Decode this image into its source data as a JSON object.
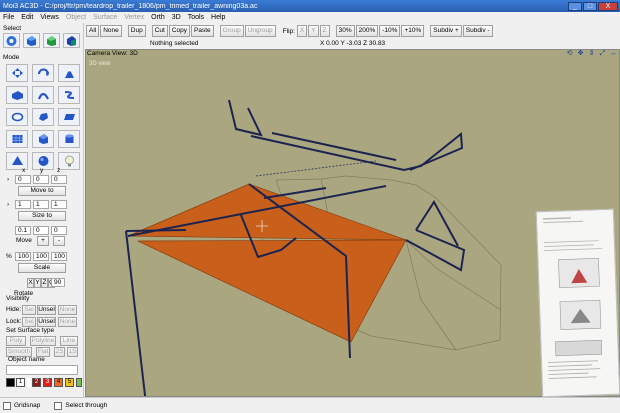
{
  "window": {
    "title": "Moi3 AC3D - C:/proj/ftr/pm/teardrop_trailer_1806/pm_trimed_trailer_awning03a.ac",
    "min": "_",
    "max": "□",
    "close": "X"
  },
  "menu": [
    "File",
    "Edit",
    "Views",
    "Object",
    "Surface",
    "Vertex",
    "Orth",
    "3D",
    "Tools",
    "Help"
  ],
  "menu_disabled": [
    false,
    false,
    false,
    true,
    true,
    true,
    false,
    false,
    false,
    false
  ],
  "toolbar": {
    "buttons": [
      "All",
      "None",
      "Dup",
      "Cut",
      "Copy",
      "Paste",
      "Group",
      "Ungroup"
    ],
    "disabled": [
      false,
      false,
      false,
      false,
      false,
      false,
      true,
      true
    ],
    "flip_label": "Flip:",
    "flip": [
      "X",
      "Y",
      "Z"
    ],
    "zoom": [
      "30%",
      "200%",
      "-10%",
      "+10%"
    ],
    "subdiv_plus": "Subdiv +",
    "subdiv_minus": "Subdiv -",
    "selection_status": "Nothing selected",
    "coords": "X 0.00 Y -3.03 Z 30.83"
  },
  "left": {
    "select_label": "Select",
    "mode_label": "Mode",
    "xyz": [
      "x",
      "y",
      "z"
    ],
    "move_fields": [
      "0",
      "0",
      "0"
    ],
    "move_to": "Move to",
    "size_fields": [
      "1",
      "1",
      "1"
    ],
    "size_to": "Size to",
    "step_fields": [
      "0.1",
      "0",
      "0"
    ],
    "move_label": "Move",
    "plus": "+",
    "minus": "-",
    "pct": "%",
    "scale_fields": [
      "100",
      "100",
      "100"
    ],
    "scale": "Scale",
    "axes": [
      "X",
      "Y",
      "Z",
      "C"
    ],
    "angle": "90",
    "rotate": "Rotate",
    "visibility_label": "Visibility",
    "hide_label": "Hide:",
    "lock_label": "Lock:",
    "vis_buttons": [
      "Sel",
      "Unsel",
      "None"
    ],
    "surface_type_label": "Set Surface type",
    "surface_buttons_1": [
      "Poly",
      "Polyline",
      "Line"
    ],
    "surface_buttons_2": [
      "Smooth",
      "Flat",
      "2S",
      "1S"
    ],
    "object_name_label": "Object name",
    "palette_numbers": [
      "1",
      "2",
      "3",
      "4",
      "5"
    ],
    "palette_colors": [
      "#000000",
      "#ffffff",
      "#8b1a1a",
      "#e02020",
      "#f06a1c",
      "#f0c020",
      "#7ac050"
    ]
  },
  "viewport": {
    "camera_label": "Camera  View: 3D",
    "hint": "3D view"
  },
  "bottom": {
    "gridsnap": "Gridsnap",
    "select_through": "Select through"
  }
}
